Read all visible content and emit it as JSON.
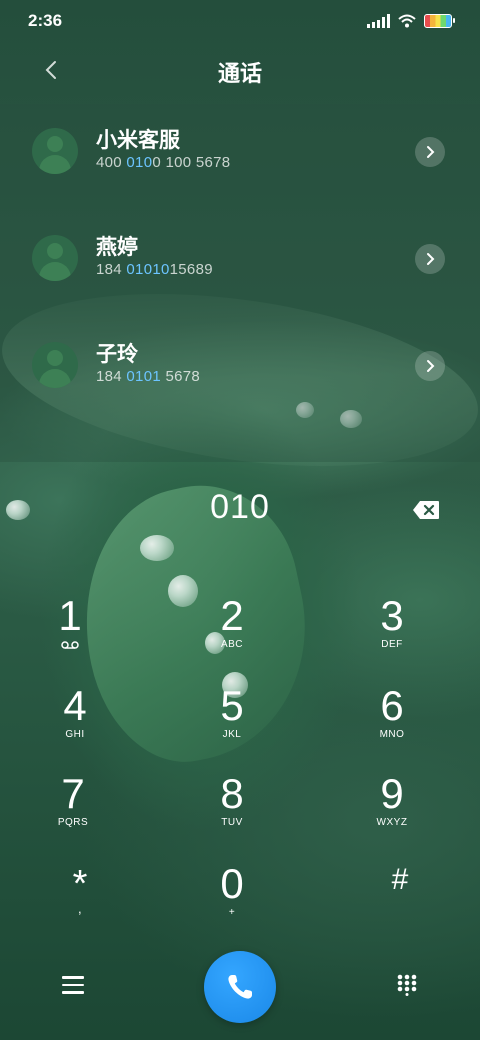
{
  "status_bar": {
    "time": "2:36"
  },
  "header": {
    "title": "通话"
  },
  "contacts": [
    {
      "name": "小米客服",
      "number_parts": [
        "400 ",
        "010",
        "0 100",
        " 5678"
      ]
    },
    {
      "name": "燕婷",
      "number_parts": [
        "184 ",
        "010",
        "10",
        "15689"
      ]
    },
    {
      "name": "子玲",
      "number_parts": [
        "184 ",
        "0101",
        "",
        " 5678"
      ]
    }
  ],
  "dial": {
    "input": "010"
  },
  "keys": [
    {
      "digit": "1",
      "letters": ""
    },
    {
      "digit": "2",
      "letters": "ABC"
    },
    {
      "digit": "3",
      "letters": "DEF"
    },
    {
      "digit": "4",
      "letters": "GHI"
    },
    {
      "digit": "5",
      "letters": "JKL"
    },
    {
      "digit": "6",
      "letters": "MNO"
    },
    {
      "digit": "7",
      "letters": "PQRS"
    },
    {
      "digit": "8",
      "letters": "TUV"
    },
    {
      "digit": "9",
      "letters": "WXYZ"
    },
    {
      "digit": "*",
      "letters": ","
    },
    {
      "digit": "0",
      "letters": "+"
    },
    {
      "digit": "#",
      "letters": ""
    }
  ],
  "colors": {
    "highlight": "#6cc4ff",
    "call_button": "#1a88e8"
  },
  "icons": [
    "back-icon",
    "chevron-right-icon",
    "backspace-icon",
    "voicemail-icon",
    "menu-icon",
    "phone-icon",
    "dialpad-icon",
    "wifi-icon",
    "signal-icon",
    "battery-icon"
  ]
}
